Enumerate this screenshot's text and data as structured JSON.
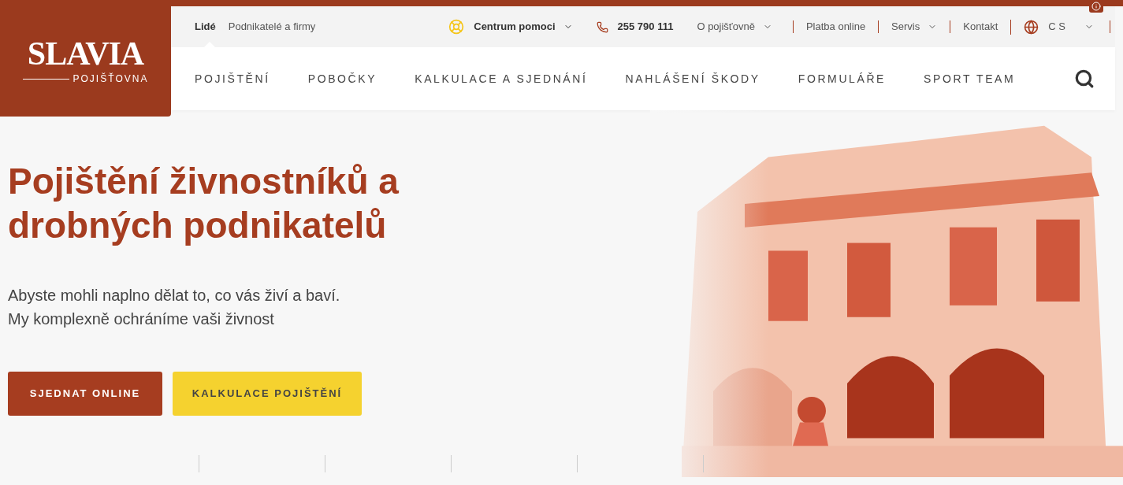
{
  "logo": {
    "name": "SLAVIA",
    "subtitle": "POJIŠŤOVNA"
  },
  "audience_tabs": [
    {
      "label": "Lidé",
      "selected": true
    },
    {
      "label": "Podnikatelé a firmy",
      "selected": false
    }
  ],
  "utility_links": [
    {
      "kind": "help",
      "label": "Centrum pomoci",
      "dropdown": true,
      "divider": false
    },
    {
      "kind": "phone",
      "label": "255 790 111",
      "dropdown": false,
      "divider": false
    },
    {
      "kind": "link",
      "label": "O pojišťovně",
      "dropdown": true,
      "divider": false
    },
    {
      "kind": "link",
      "label": "Platba online",
      "dropdown": false,
      "divider": true
    },
    {
      "kind": "link",
      "label": "Servis",
      "dropdown": true,
      "divider": true
    },
    {
      "kind": "link",
      "label": "Kontakt",
      "dropdown": false,
      "divider": true
    },
    {
      "kind": "language",
      "label": "C S",
      "dropdown": true,
      "divider": true
    }
  ],
  "nav": [
    "POJIŠTĚNÍ",
    "POBOČKY",
    "KALKULACE A SJEDNÁNÍ",
    "NAHLÁŠENÍ ŠKODY",
    "FORMULÁŘE",
    "SPORT TEAM"
  ],
  "hero": {
    "title": "Pojištění živnostníků a drobných podnikatelů",
    "lines": [
      "Abyste mohli naplno dělat to, co vás živí a baví.",
      "My komplexně ochráníme vaši živnost"
    ],
    "buttons": [
      {
        "label": "SJEDNAT ONLINE",
        "kind": "primary"
      },
      {
        "label": "KALKULACE POJIŠTĚNÍ",
        "kind": "secondary"
      }
    ]
  }
}
